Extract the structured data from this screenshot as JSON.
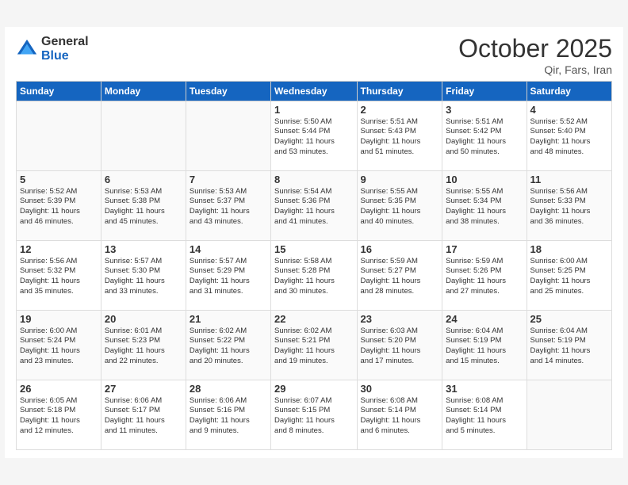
{
  "header": {
    "logo_line1": "General",
    "logo_line2": "Blue",
    "month": "October 2025",
    "location": "Qir, Fars, Iran"
  },
  "weekdays": [
    "Sunday",
    "Monday",
    "Tuesday",
    "Wednesday",
    "Thursday",
    "Friday",
    "Saturday"
  ],
  "weeks": [
    [
      {
        "day": "",
        "info": ""
      },
      {
        "day": "",
        "info": ""
      },
      {
        "day": "",
        "info": ""
      },
      {
        "day": "1",
        "info": "Sunrise: 5:50 AM\nSunset: 5:44 PM\nDaylight: 11 hours\nand 53 minutes."
      },
      {
        "day": "2",
        "info": "Sunrise: 5:51 AM\nSunset: 5:43 PM\nDaylight: 11 hours\nand 51 minutes."
      },
      {
        "day": "3",
        "info": "Sunrise: 5:51 AM\nSunset: 5:42 PM\nDaylight: 11 hours\nand 50 minutes."
      },
      {
        "day": "4",
        "info": "Sunrise: 5:52 AM\nSunset: 5:40 PM\nDaylight: 11 hours\nand 48 minutes."
      }
    ],
    [
      {
        "day": "5",
        "info": "Sunrise: 5:52 AM\nSunset: 5:39 PM\nDaylight: 11 hours\nand 46 minutes."
      },
      {
        "day": "6",
        "info": "Sunrise: 5:53 AM\nSunset: 5:38 PM\nDaylight: 11 hours\nand 45 minutes."
      },
      {
        "day": "7",
        "info": "Sunrise: 5:53 AM\nSunset: 5:37 PM\nDaylight: 11 hours\nand 43 minutes."
      },
      {
        "day": "8",
        "info": "Sunrise: 5:54 AM\nSunset: 5:36 PM\nDaylight: 11 hours\nand 41 minutes."
      },
      {
        "day": "9",
        "info": "Sunrise: 5:55 AM\nSunset: 5:35 PM\nDaylight: 11 hours\nand 40 minutes."
      },
      {
        "day": "10",
        "info": "Sunrise: 5:55 AM\nSunset: 5:34 PM\nDaylight: 11 hours\nand 38 minutes."
      },
      {
        "day": "11",
        "info": "Sunrise: 5:56 AM\nSunset: 5:33 PM\nDaylight: 11 hours\nand 36 minutes."
      }
    ],
    [
      {
        "day": "12",
        "info": "Sunrise: 5:56 AM\nSunset: 5:32 PM\nDaylight: 11 hours\nand 35 minutes."
      },
      {
        "day": "13",
        "info": "Sunrise: 5:57 AM\nSunset: 5:30 PM\nDaylight: 11 hours\nand 33 minutes."
      },
      {
        "day": "14",
        "info": "Sunrise: 5:57 AM\nSunset: 5:29 PM\nDaylight: 11 hours\nand 31 minutes."
      },
      {
        "day": "15",
        "info": "Sunrise: 5:58 AM\nSunset: 5:28 PM\nDaylight: 11 hours\nand 30 minutes."
      },
      {
        "day": "16",
        "info": "Sunrise: 5:59 AM\nSunset: 5:27 PM\nDaylight: 11 hours\nand 28 minutes."
      },
      {
        "day": "17",
        "info": "Sunrise: 5:59 AM\nSunset: 5:26 PM\nDaylight: 11 hours\nand 27 minutes."
      },
      {
        "day": "18",
        "info": "Sunrise: 6:00 AM\nSunset: 5:25 PM\nDaylight: 11 hours\nand 25 minutes."
      }
    ],
    [
      {
        "day": "19",
        "info": "Sunrise: 6:00 AM\nSunset: 5:24 PM\nDaylight: 11 hours\nand 23 minutes."
      },
      {
        "day": "20",
        "info": "Sunrise: 6:01 AM\nSunset: 5:23 PM\nDaylight: 11 hours\nand 22 minutes."
      },
      {
        "day": "21",
        "info": "Sunrise: 6:02 AM\nSunset: 5:22 PM\nDaylight: 11 hours\nand 20 minutes."
      },
      {
        "day": "22",
        "info": "Sunrise: 6:02 AM\nSunset: 5:21 PM\nDaylight: 11 hours\nand 19 minutes."
      },
      {
        "day": "23",
        "info": "Sunrise: 6:03 AM\nSunset: 5:20 PM\nDaylight: 11 hours\nand 17 minutes."
      },
      {
        "day": "24",
        "info": "Sunrise: 6:04 AM\nSunset: 5:19 PM\nDaylight: 11 hours\nand 15 minutes."
      },
      {
        "day": "25",
        "info": "Sunrise: 6:04 AM\nSunset: 5:19 PM\nDaylight: 11 hours\nand 14 minutes."
      }
    ],
    [
      {
        "day": "26",
        "info": "Sunrise: 6:05 AM\nSunset: 5:18 PM\nDaylight: 11 hours\nand 12 minutes."
      },
      {
        "day": "27",
        "info": "Sunrise: 6:06 AM\nSunset: 5:17 PM\nDaylight: 11 hours\nand 11 minutes."
      },
      {
        "day": "28",
        "info": "Sunrise: 6:06 AM\nSunset: 5:16 PM\nDaylight: 11 hours\nand 9 minutes."
      },
      {
        "day": "29",
        "info": "Sunrise: 6:07 AM\nSunset: 5:15 PM\nDaylight: 11 hours\nand 8 minutes."
      },
      {
        "day": "30",
        "info": "Sunrise: 6:08 AM\nSunset: 5:14 PM\nDaylight: 11 hours\nand 6 minutes."
      },
      {
        "day": "31",
        "info": "Sunrise: 6:08 AM\nSunset: 5:14 PM\nDaylight: 11 hours\nand 5 minutes."
      },
      {
        "day": "",
        "info": ""
      }
    ]
  ]
}
